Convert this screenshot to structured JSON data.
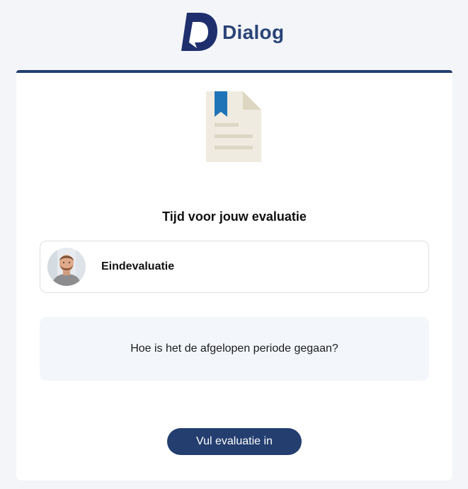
{
  "header": {
    "logo_text": "Dialog"
  },
  "card": {
    "title": "Tijd voor jouw evaluatie",
    "evaluation": {
      "label": "Eindevaluatie",
      "avatar_icon": "avatar"
    },
    "question": "Hoe is het de afgelopen periode gegaan?",
    "cta_label": "Vul evaluatie in",
    "icon": "document-bookmark-icon"
  },
  "colors": {
    "brand": "#233e6f",
    "background": "#f3f5f8",
    "card": "#ffffff",
    "question_bg": "#f3f6fa",
    "bookmark": "#1f74b8"
  }
}
